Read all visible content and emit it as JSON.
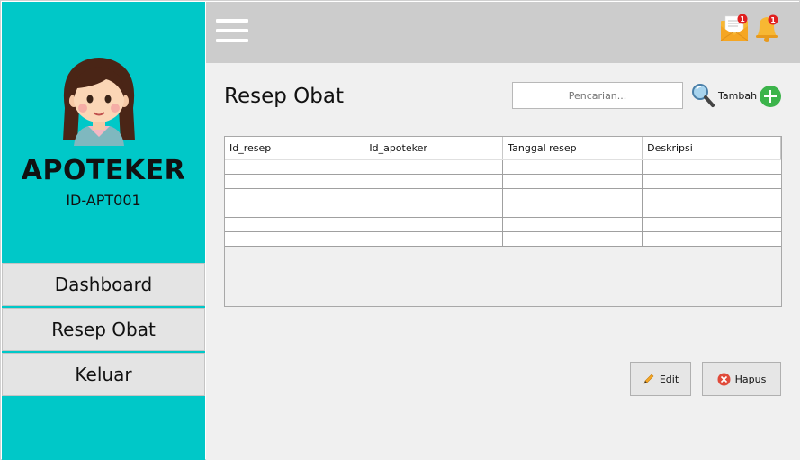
{
  "sidebar": {
    "role": "APOTEKER",
    "user_id": "ID-APT001",
    "nav": [
      {
        "label": "Dashboard"
      },
      {
        "label": "Resep Obat"
      },
      {
        "label": "Keluar"
      }
    ]
  },
  "topbar": {
    "mail_badge": "1",
    "bell_badge": "1"
  },
  "main": {
    "title": "Resep Obat",
    "search_placeholder": "Pencarian...",
    "add_label": "Tambah",
    "table": {
      "columns": [
        "Id_resep",
        "Id_apoteker",
        "Tanggal resep",
        "Deskripsi"
      ],
      "rows": [
        [
          "",
          "",
          "",
          ""
        ],
        [
          "",
          "",
          "",
          ""
        ],
        [
          "",
          "",
          "",
          ""
        ],
        [
          "",
          "",
          "",
          ""
        ],
        [
          "",
          "",
          "",
          ""
        ],
        [
          "",
          "",
          "",
          ""
        ]
      ]
    },
    "edit_label": "Edit",
    "delete_label": "Hapus"
  },
  "colors": {
    "sidebar": "#00c8c8",
    "topbar": "#cccccc",
    "content": "#f0f0f0",
    "add_button": "#3cb44b",
    "delete_icon": "#e04a3a"
  },
  "icons": {
    "menu": "hamburger-menu-icon",
    "mail": "mail-icon",
    "bell": "bell-icon",
    "search": "magnifier-search-icon",
    "add": "plus-circle-icon",
    "edit": "pencil-icon",
    "delete": "x-circle-icon"
  }
}
